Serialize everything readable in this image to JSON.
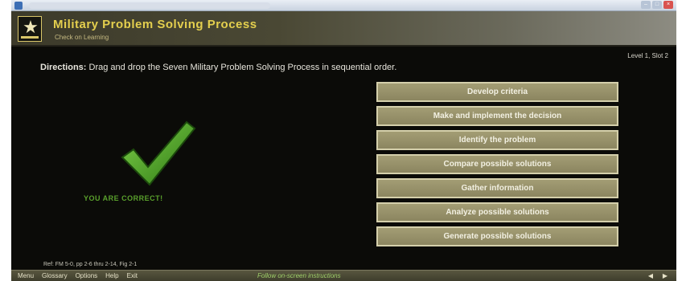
{
  "header": {
    "title": "Military Problem Solving Process",
    "subtitle": "Check on Learning"
  },
  "level": "Level 1, Slot 2",
  "directions": {
    "label": "Directions:",
    "text": "Drag and drop the Seven Military Problem Solving Process in sequential order."
  },
  "feedback": {
    "message": "YOU ARE CORRECT!",
    "icon": "checkmark-icon",
    "color": "#4ea024"
  },
  "steps": [
    "Develop criteria",
    "Make and implement the decision",
    "Identify the problem",
    "Compare possible solutions",
    "Gather information",
    "Analyze possible solutions",
    "Generate possible solutions"
  ],
  "reference": "Ref: FM 5-0, pp 2-6 thru 2-14, Fig 2-1",
  "bottom_nav": [
    "Menu",
    "Glossary",
    "Options",
    "Help",
    "Exit"
  ],
  "status": "Follow on-screen instructions",
  "colors": {
    "title": "#e4cf4e",
    "step_fill": "#9a946b",
    "step_border": "#d4cfab",
    "background": "#0b0b08"
  }
}
